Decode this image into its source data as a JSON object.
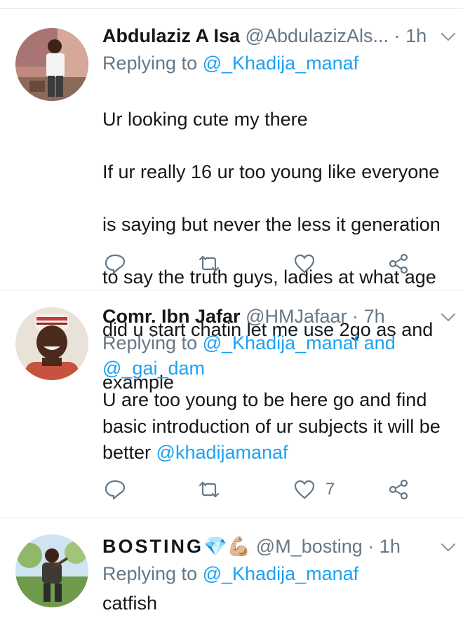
{
  "tweets": [
    {
      "name": "Abdulaziz A Isa",
      "handle": "@AbdulazizAls...",
      "time": "1h",
      "reply_prefix": "Replying to",
      "reply_mentions": "@_Khadija_manaf",
      "reply_line2": "",
      "body_lines": [
        "Ur looking cute my there",
        "If ur really 16 ur too young like everyone",
        "is saying but never the less it generation",
        "to say the truth guys, ladies at what age",
        "did u start chatin let me use 2go as and",
        "example"
      ],
      "like_count": ""
    },
    {
      "name": "Comr. Ibn Jafar",
      "handle": "@HMJafaar",
      "time": "7h",
      "reply_prefix": "Replying to",
      "reply_mentions": "@_Khadija_manaf and",
      "reply_line2": "@_gai_dam",
      "body_text_1": "U are too young to be here go and find",
      "body_text_2": "basic introduction of ur subjects it will be",
      "body_text_3": "better ",
      "body_mention": "@khadijamanaf",
      "like_count": "7"
    },
    {
      "name": "BOSTING",
      "name_emoji": "💎💪🏼",
      "handle": "@M_bosting",
      "time": "1h",
      "reply_prefix": "Replying to",
      "reply_mentions": "@_Khadija_manaf",
      "body": "catfish"
    }
  ],
  "colors": {
    "text": "#14171a",
    "secondary": "#657786",
    "link": "#1da1f2",
    "divider": "#e1e8ed"
  },
  "icons": [
    "reply-icon",
    "retweet-icon",
    "like-icon",
    "share-icon",
    "caret-down-icon"
  ]
}
